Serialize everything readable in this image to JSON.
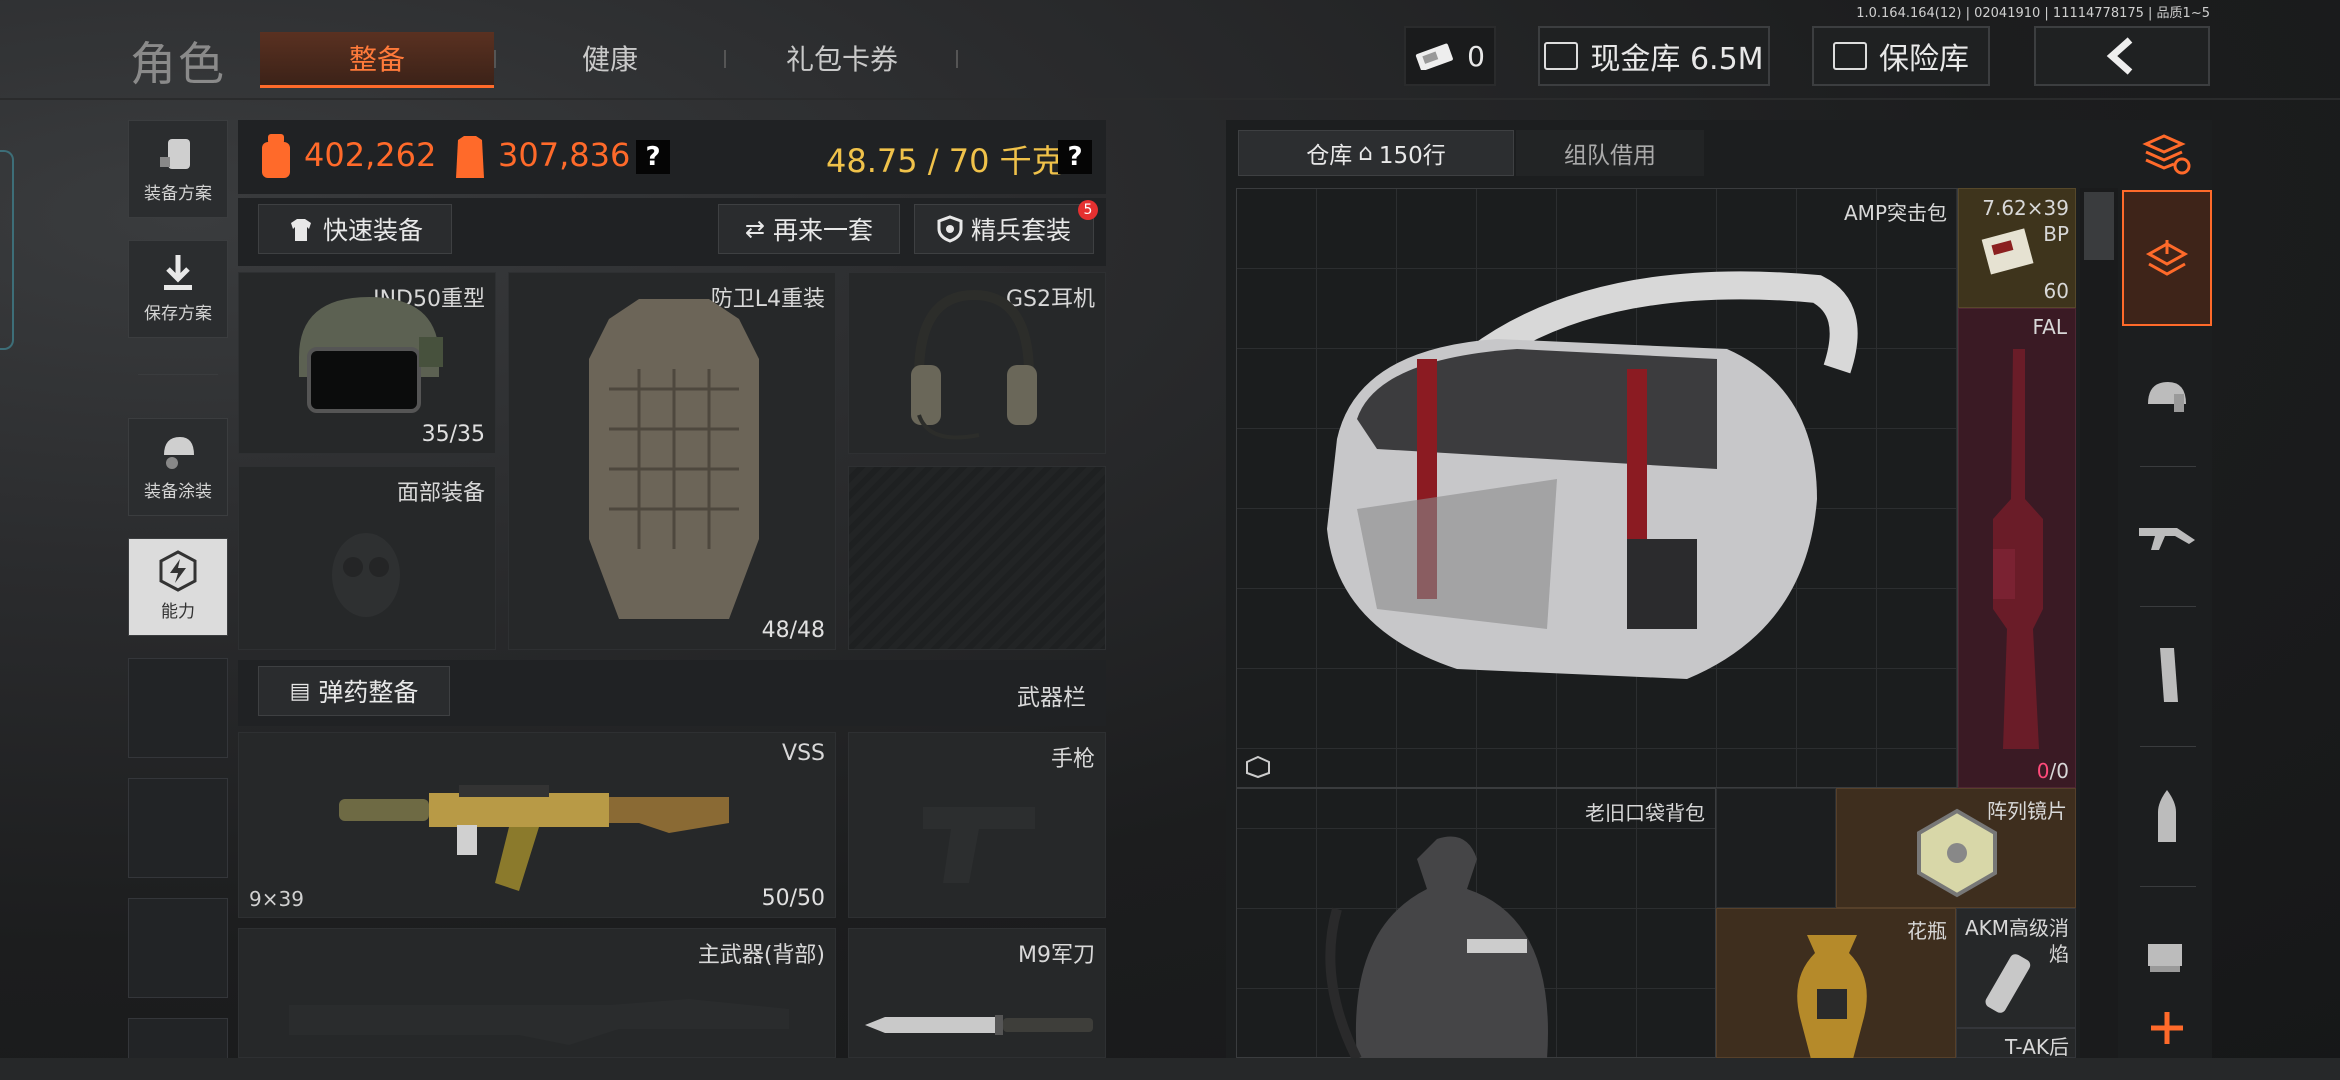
{
  "version": "1.0.164.164(12) | 02041910 | 11114778175 | 品质1~5",
  "nav": {
    "title": "角色",
    "tabs": [
      {
        "label": "整备",
        "active": true
      },
      {
        "label": "健康",
        "active": false
      },
      {
        "label": "礼包卡券",
        "active": false
      }
    ]
  },
  "topbar": {
    "money_count": "0",
    "cash_vault": "现金库 6.5M",
    "safe_box": "保险库"
  },
  "sidebar": {
    "items": [
      {
        "label": "装备方案"
      },
      {
        "label": "保存方案"
      },
      {
        "label": "装备涂装"
      },
      {
        "label": "能力"
      }
    ]
  },
  "stats": {
    "backpack_value": "402,262",
    "armor_value": "307,836",
    "weight": "48.75 / 70 千克",
    "help": "?"
  },
  "actions": {
    "quick_equip": "快速装备",
    "again": "再来一套",
    "elite_set": "精兵套装",
    "elite_badge": "5",
    "ammo_equip": "弹药整备",
    "weapon_bar": "武器栏"
  },
  "gear": {
    "helmet": {
      "name": "IND50重型",
      "durability": "35/35"
    },
    "armor": {
      "name": "防卫L4重装",
      "durability": "48/48"
    },
    "headset": {
      "name": "GS2耳机"
    },
    "face": {
      "name": "面部装备"
    }
  },
  "weapons": {
    "primary": {
      "name": "VSS",
      "caliber": "9×39",
      "ammo": "50/50"
    },
    "pistol": {
      "name": "手枪"
    },
    "back": {
      "name": "主武器(背部)"
    },
    "knife": {
      "name": "M9军刀"
    }
  },
  "storage": {
    "tab_warehouse": "仓库",
    "rows": "150行",
    "tab_team": "组队借用",
    "items": [
      {
        "name": "AMP突击包"
      },
      {
        "name": "7.62×39 BP",
        "count": "60"
      },
      {
        "name": "FAL",
        "ammo_current": "0",
        "ammo_sep": "/0"
      },
      {
        "name": "老旧口袋背包"
      },
      {
        "name": "阵列镜片"
      },
      {
        "name": "花瓶"
      },
      {
        "name": "AKM高级消焰"
      },
      {
        "name": "T-AK后"
      }
    ]
  },
  "colors": {
    "accent": "#ff6a2a",
    "gold": "#f0c24a",
    "rare_red": "#3a1a20",
    "rare_gold": "#3e2e1a"
  }
}
